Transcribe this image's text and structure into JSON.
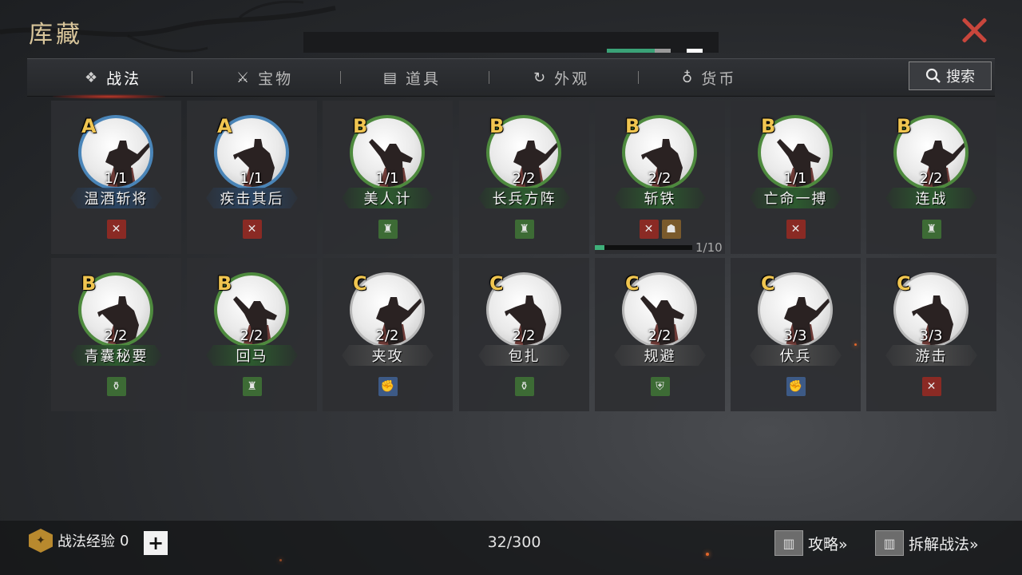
{
  "window": {
    "title": "库藏",
    "close_icon": "close-x-icon",
    "accent_color": "#c8463c"
  },
  "tabs": [
    {
      "label": "战法",
      "icon": "scroll-bundle-icon",
      "active": true
    },
    {
      "label": "宝物",
      "icon": "treasure-cannon-icon",
      "active": false
    },
    {
      "label": "道具",
      "icon": "chest-icon",
      "active": false
    },
    {
      "label": "外观",
      "icon": "refresh-cycle-icon",
      "active": false
    },
    {
      "label": "货币",
      "icon": "coin-bag-icon",
      "active": false
    }
  ],
  "search": {
    "label": "搜索",
    "icon": "search-icon"
  },
  "cards": [
    {
      "grade": "A",
      "count": "1/1",
      "name": "温酒斩将",
      "badges": [
        {
          "icon": "crossed-swords-icon",
          "color": "red"
        }
      ]
    },
    {
      "grade": "A",
      "count": "1/1",
      "name": "疾击其后",
      "badges": [
        {
          "icon": "crossed-swords-icon",
          "color": "red"
        }
      ]
    },
    {
      "grade": "B",
      "count": "1/1",
      "name": "美人计",
      "badges": [
        {
          "icon": "helmet-arrow-icon",
          "color": "green"
        }
      ]
    },
    {
      "grade": "B",
      "count": "2/2",
      "name": "长兵方阵",
      "badges": [
        {
          "icon": "helmet-arrow-icon",
          "color": "green"
        }
      ]
    },
    {
      "grade": "B",
      "count": "2/2",
      "name": "斩铁",
      "badges": [
        {
          "icon": "crossed-swords-icon",
          "color": "red"
        },
        {
          "icon": "beast-face-icon",
          "color": "brown"
        }
      ],
      "progress": {
        "text": "1/10",
        "fraction": 0.1
      }
    },
    {
      "grade": "B",
      "count": "1/1",
      "name": "亡命一搏",
      "badges": [
        {
          "icon": "crossed-swords-icon",
          "color": "red"
        }
      ]
    },
    {
      "grade": "B",
      "count": "2/2",
      "name": "连战",
      "badges": [
        {
          "icon": "helmet-arrow-icon",
          "color": "green"
        }
      ]
    },
    {
      "grade": "B",
      "count": "2/2",
      "name": "青囊秘要",
      "badges": [
        {
          "icon": "medicine-pot-icon",
          "color": "green"
        }
      ]
    },
    {
      "grade": "B",
      "count": "2/2",
      "name": "回马",
      "badges": [
        {
          "icon": "helmet-arrow-icon",
          "color": "green"
        }
      ]
    },
    {
      "grade": "C",
      "count": "2/2",
      "name": "夹攻",
      "badges": [
        {
          "icon": "fist-icon",
          "color": "blue"
        }
      ]
    },
    {
      "grade": "C",
      "count": "2/2",
      "name": "包扎",
      "badges": [
        {
          "icon": "medicine-pot-icon",
          "color": "green"
        }
      ]
    },
    {
      "grade": "C",
      "count": "2/2",
      "name": "规避",
      "badges": [
        {
          "icon": "shield-icon",
          "color": "green"
        }
      ]
    },
    {
      "grade": "C",
      "count": "3/3",
      "name": "伏兵",
      "badges": [
        {
          "icon": "fist-icon",
          "color": "blue"
        }
      ]
    },
    {
      "grade": "C",
      "count": "3/3",
      "name": "游击",
      "badges": [
        {
          "icon": "crossed-swords-icon",
          "color": "red"
        }
      ]
    }
  ],
  "footer": {
    "exp_label": "战法经验",
    "exp_value": "0",
    "exp_icon": "tactic-exp-icon",
    "add_icon": "plus-icon",
    "capacity": "32/300",
    "guide_label": "攻略»",
    "guide_icon": "scroll-book-icon",
    "dismantle_label": "拆解战法»",
    "dismantle_icon": "bamboo-scroll-icon"
  },
  "colors": {
    "grade_A_ring": "#4a85b8",
    "grade_B_ring": "#4e8a3e",
    "grade_C_ring": "#b8b8b8",
    "grade_text": "#f0c550"
  }
}
